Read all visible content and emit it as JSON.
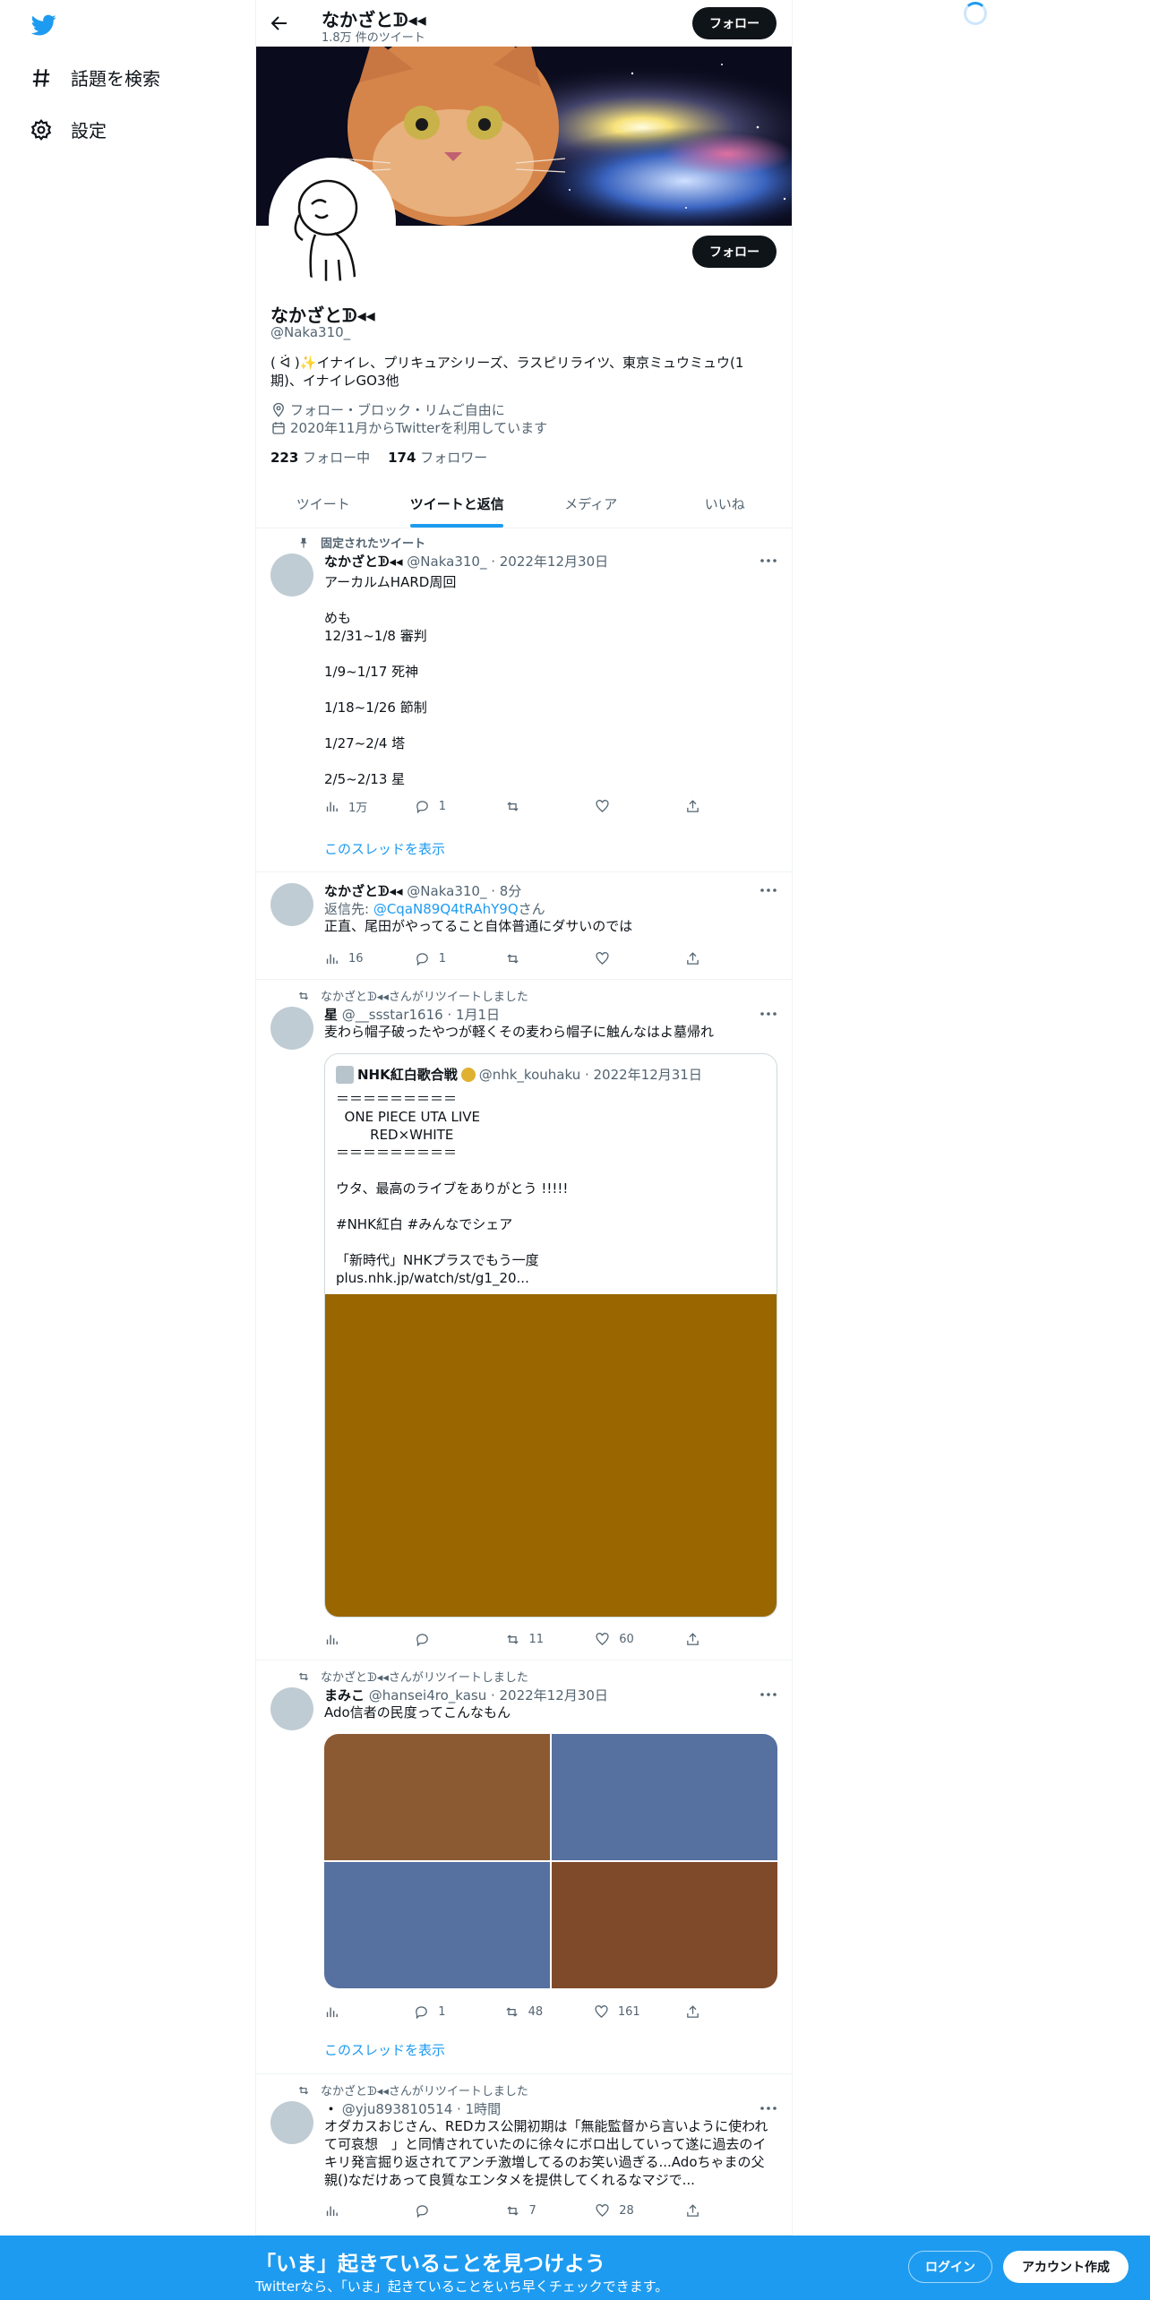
{
  "nav": {
    "explore_label": "話題を検索",
    "settings_label": "設定"
  },
  "header": {
    "name": "なかざとᗫ◂◂",
    "tweet_count": "1.8万 件のツイート",
    "follow_label": "フォロー"
  },
  "profile": {
    "name": "なかざとᗫ◂◂",
    "handle": "@Naka310_",
    "bio": "( ᐛ )✨イナイレ、プリキュアシリーズ、ラスピリライツ、東京ミュウミュウ(1期)、イナイレGO3他",
    "location": "フォロー・ブロック・リムご自由に",
    "joined": "2020年11月からTwitterを利用しています",
    "following_count": "223",
    "following_label": "フォロー中",
    "followers_count": "174",
    "followers_label": "フォロワー",
    "follow_label": "フォロー"
  },
  "tabs": [
    {
      "label": "ツイート"
    },
    {
      "label": "ツイートと返信"
    },
    {
      "label": "メディア"
    },
    {
      "label": "いいね"
    }
  ],
  "tweets": [
    {
      "context": "固定されたツイート",
      "name": "なかざとᗫ◂◂",
      "meta": "@Naka310_ · 2022年12月30日",
      "text": "アーカルムHARD周回\n\nめも\n12/31~1/8 審判\n\n1/9~1/17 死神\n\n1/18~1/26 節制\n\n1/27~2/4 塔\n\n2/5~2/13 星",
      "views": "1万",
      "replies": "1",
      "retweets": "",
      "likes": "",
      "thread_link": "このスレッドを表示"
    },
    {
      "name": "なかざとᗫ◂◂",
      "meta": "@Naka310_ · 8分",
      "reply_prefix": "返信先: ",
      "reply_to": "@CqaN89Q4tRAhY9Q",
      "reply_suffix": "さん",
      "text": "正直、尾田がやってること自体普通にダサいのでは",
      "views": "16",
      "replies": "1",
      "retweets": "",
      "likes": ""
    },
    {
      "context": "なかざとᗫ◂◂さんがリツイートしました",
      "name": "星",
      "meta": "@__ssstar1616 · 1月1日",
      "text": "麦わら帽子破ったやつが軽くその麦わら帽子に触んなはよ墓帰れ",
      "quote_name": "NHK紅白歌合戦",
      "quote_meta": "@nhk_kouhaku · 2022年12月31日",
      "quote_text": "＝＝＝＝＝＝＝＝＝\n  ONE PIECE UTA LIVE\n        RED×WHITE\n＝＝＝＝＝＝＝＝＝\n\nウタ、最高のライブをありがとう !!!!!\n\n#NHK紅白 #みんなでシェア\n\n「新時代」NHKプラスでもう一度\nplus.nhk.jp/watch/st/g1_20...",
      "views": "",
      "replies": "",
      "retweets": "11",
      "likes": "60"
    },
    {
      "context": "なかざとᗫ◂◂さんがリツイートしました",
      "name": "まみこ",
      "meta": "@hansei4ro_kasu · 2022年12月30日",
      "text": "Ado信者の民度ってこんなもん",
      "views": "",
      "replies": "1",
      "retweets": "48",
      "likes": "161",
      "thread_link": "このスレッドを表示"
    },
    {
      "context": "なかざとᗫ◂◂さんがリツイートしました",
      "name": "・",
      "meta": "@yju893810514 · 1時間",
      "text": "オダカスおじさん、REDカス公開初期は「無能監督から言いように使われて可哀想　」と同情されていたのに徐々にボロ出していって遂に過去のイキリ発言掘り返されてアンチ激増してるのお笑い過ぎる...Adoちゃまの父親()なだけあって良質なエンタメを提供してくれるなマジで...",
      "views": "",
      "replies": "",
      "retweets": "7",
      "likes": "28"
    }
  ],
  "bottom_bar": {
    "title": "「いま」起きていることを見つけよう",
    "subtitle": "Twitterなら、「いま」起きていることをいち早くチェックできます。",
    "login_label": "ログイン",
    "signup_label": "アカウント作成"
  },
  "colors": {
    "accent": "#1d9bf0",
    "quote_media": "#996600",
    "grid_1": "#8b5a33",
    "grid_2": "#5670a0",
    "grid_3": "#5670a0",
    "grid_4": "#7f4a2a"
  }
}
